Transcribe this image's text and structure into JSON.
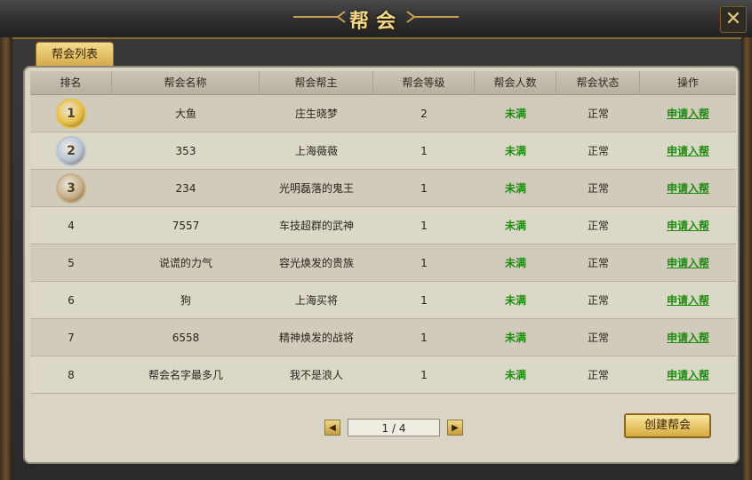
{
  "window": {
    "title": "帮会",
    "close_glyph": "✕"
  },
  "tab": {
    "label": "帮会列表"
  },
  "columns": [
    "排名",
    "帮会名称",
    "帮会帮主",
    "帮会等级",
    "帮会人数",
    "帮会状态",
    "操作"
  ],
  "rows": [
    {
      "rank": "1",
      "name": "大鱼",
      "leader": "庄生晓梦",
      "level": "2",
      "members": "未满",
      "status": "正常",
      "action": "申请入帮"
    },
    {
      "rank": "2",
      "name": "353",
      "leader": "上海薇薇",
      "level": "1",
      "members": "未满",
      "status": "正常",
      "action": "申请入帮"
    },
    {
      "rank": "3",
      "name": "234",
      "leader": "光明磊落的鬼王",
      "level": "1",
      "members": "未满",
      "status": "正常",
      "action": "申请入帮"
    },
    {
      "rank": "4",
      "name": "7557",
      "leader": "车技超群的武神",
      "level": "1",
      "members": "未满",
      "status": "正常",
      "action": "申请入帮"
    },
    {
      "rank": "5",
      "name": "说谎的力气",
      "leader": "容光焕发的贵族",
      "level": "1",
      "members": "未满",
      "status": "正常",
      "action": "申请入帮"
    },
    {
      "rank": "6",
      "name": "狗",
      "leader": "上海买将",
      "level": "1",
      "members": "未满",
      "status": "正常",
      "action": "申请入帮"
    },
    {
      "rank": "7",
      "name": "6558",
      "leader": "精神焕发的战将",
      "level": "1",
      "members": "未满",
      "status": "正常",
      "action": "申请入帮"
    },
    {
      "rank": "8",
      "name": "帮会名字最多几",
      "leader": "我不是浪人",
      "level": "1",
      "members": "未满",
      "status": "正常",
      "action": "申请入帮"
    }
  ],
  "medals": [
    {
      "rank": "1",
      "color": "#e8c048"
    },
    {
      "rank": "2",
      "color": "#b8c4d4"
    },
    {
      "rank": "3",
      "color": "#c8b088"
    }
  ],
  "pager": {
    "prev_icon": "◀",
    "next_icon": "▶",
    "page_text": "1 / 4"
  },
  "buttons": {
    "create": "创建帮会"
  }
}
